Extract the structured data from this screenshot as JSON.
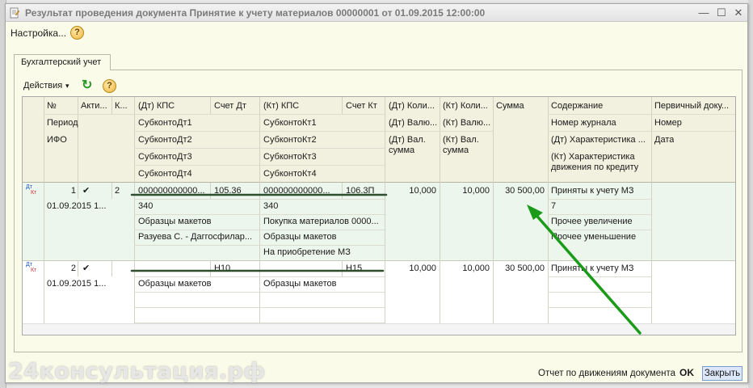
{
  "window": {
    "title": "Результат проведения документа Принятие к учету материалов 00000001 от 01.09.2015 12:00:00",
    "minimize_glyph": "—",
    "restore_glyph": "☐",
    "close_glyph": "✕"
  },
  "menubar": {
    "settings_label": "Настройка...",
    "help_glyph": "?"
  },
  "tabs": [
    {
      "label": "Бухгалтерский учет"
    }
  ],
  "toolbar": {
    "actions_label": "Действия",
    "actions_arrow": "▾",
    "refresh_glyph": "↻",
    "help_glyph": "?"
  },
  "grid": {
    "headers": {
      "num": "№",
      "active": "Акти...",
      "k": "К...",
      "period": "Период",
      "ifo": "ИФО",
      "dt_kps": "(Дт) КПС",
      "dt_account": "Счет Дт",
      "dt_sub1": "СубконтоДт1",
      "dt_sub2": "СубконтоДт2",
      "dt_sub3": "СубконтоДт3",
      "dt_sub4": "СубконтоДт4",
      "kt_kps": "(Кт) КПС",
      "kt_account": "Счет Кт",
      "kt_sub1": "СубконтоКт1",
      "kt_sub2": "СубконтоКт2",
      "kt_sub3": "СубконтоКт3",
      "kt_sub4": "СубконтоКт4",
      "dt_qty": "(Дт) Коли...",
      "dt_cur": "(Дт) Валю...",
      "dt_cur_sum_1": "(Дт) Вал.",
      "dt_cur_sum_2": "сумма",
      "kt_qty": "(Кт) Коли...",
      "kt_cur": "(Кт) Валю...",
      "kt_cur_sum_1": "(Кт) Вал.",
      "kt_cur_sum_2": "сумма",
      "sum": "Сумма",
      "content": "Содержание",
      "journal": "Номер журнала",
      "dt_char": "(Дт) Характеристика ...",
      "kt_char_1": "(Кт) Характеристика",
      "kt_char_2": "движения по кредиту",
      "primary_doc": "Первичный доку...",
      "number": "Номер",
      "date": "Дата"
    },
    "rows": [
      {
        "icon_dt": "Дт",
        "icon_kt": "Кт",
        "num": "1",
        "active": "✔",
        "k": "2",
        "period": "01.09.2015 1...",
        "dt_kps": "000000000000...",
        "dt_account": "105.36",
        "dt_sub1": "340",
        "dt_sub2": "Образцы макетов",
        "dt_sub3": "Разуева С. - Даггосфилар...",
        "dt_sub4": "",
        "kt_kps": "000000000000...",
        "kt_account": "106.3П",
        "kt_sub1": "340",
        "kt_sub2": "Покупка материалов 0000...",
        "kt_sub3": "Образцы макетов",
        "kt_sub4": "На приобретение МЗ",
        "dt_qty": "10,000",
        "kt_qty": "10,000",
        "sum": "30 500,00",
        "content": "Приняты к учету МЗ",
        "journal": "7",
        "dt_char": "Прочее увеличение",
        "kt_char": "Прочее уменьшение"
      },
      {
        "icon_dt": "Дт",
        "icon_kt": "Кт",
        "num": "2",
        "active": "✔",
        "k": "",
        "period": "01.09.2015 1...",
        "dt_kps": "",
        "dt_account": "Н10",
        "dt_sub1": "Образцы макетов",
        "kt_kps": "",
        "kt_account": "Н15",
        "kt_sub1": "Образцы макетов",
        "dt_qty": "10,000",
        "kt_qty": "10,000",
        "sum": "30 500,00",
        "content": "Приняты к учету МЗ"
      }
    ]
  },
  "footer": {
    "report_link": "Отчет по движениям документа",
    "ok_label": "OK",
    "close_label": "Закрыть"
  },
  "watermark": "24консультация.рф",
  "colors": {
    "window_bg": "#fbfbe9",
    "selected_row_bg": "#edf6ec",
    "annotation_green": "#1a9c1a",
    "underline_dark": "#2d4f2d"
  }
}
